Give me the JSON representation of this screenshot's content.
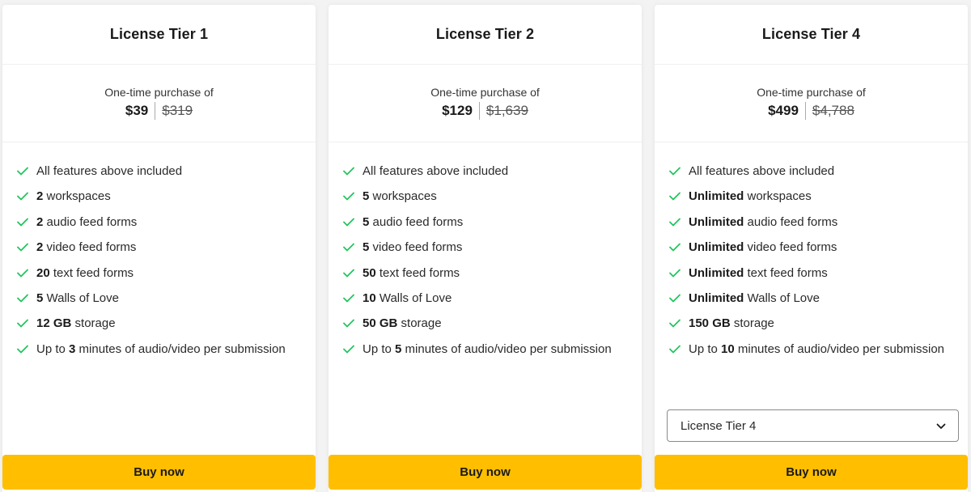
{
  "colors": {
    "accent": "#ffbe00",
    "check": "#22c55e",
    "background": "#f3f3f3"
  },
  "cards": [
    {
      "title": "License Tier 1",
      "price_caption": "One-time purchase of",
      "price": "$39",
      "original_price": "$319",
      "features": [
        {
          "bold": "",
          "text": "All features above included"
        },
        {
          "bold": "2",
          "text": " workspaces"
        },
        {
          "bold": "2",
          "text": " audio feed forms"
        },
        {
          "bold": "2",
          "text": " video feed forms"
        },
        {
          "bold": "20",
          "text": " text feed forms"
        },
        {
          "bold": "5",
          "text": " Walls of Love"
        },
        {
          "bold": "12 GB",
          "text": " storage"
        },
        {
          "pre": "Up to ",
          "bold": "3",
          "text": " minutes of audio/video per submission"
        }
      ],
      "buy_label": "Buy now"
    },
    {
      "title": "License Tier 2",
      "price_caption": "One-time purchase of",
      "price": "$129",
      "original_price": "$1,639",
      "features": [
        {
          "bold": "",
          "text": "All features above included"
        },
        {
          "bold": "5",
          "text": " workspaces"
        },
        {
          "bold": "5",
          "text": " audio feed forms"
        },
        {
          "bold": "5",
          "text": " video feed forms"
        },
        {
          "bold": "50",
          "text": " text feed forms"
        },
        {
          "bold": "10",
          "text": " Walls of Love"
        },
        {
          "bold": "50 GB",
          "text": " storage"
        },
        {
          "pre": "Up to ",
          "bold": "5",
          "text": " minutes of audio/video per submission"
        }
      ],
      "buy_label": "Buy now"
    },
    {
      "title": "License Tier 4",
      "price_caption": "One-time purchase of",
      "price": "$499",
      "original_price": "$4,788",
      "features": [
        {
          "bold": "",
          "text": "All features above included"
        },
        {
          "bold": "Unlimited",
          "text": " workspaces"
        },
        {
          "bold": "Unlimited",
          "text": " audio feed forms"
        },
        {
          "bold": "Unlimited",
          "text": " video feed forms"
        },
        {
          "bold": "Unlimited",
          "text": " text feed forms"
        },
        {
          "bold": "Unlimited",
          "text": " Walls of Love"
        },
        {
          "bold": "150 GB",
          "text": " storage"
        },
        {
          "pre": "Up to ",
          "bold": "10",
          "text": " minutes of audio/video per submission"
        }
      ],
      "tier_select": {
        "value": "License Tier 4",
        "icon": "chevron-down-icon"
      },
      "buy_label": "Buy now"
    }
  ]
}
